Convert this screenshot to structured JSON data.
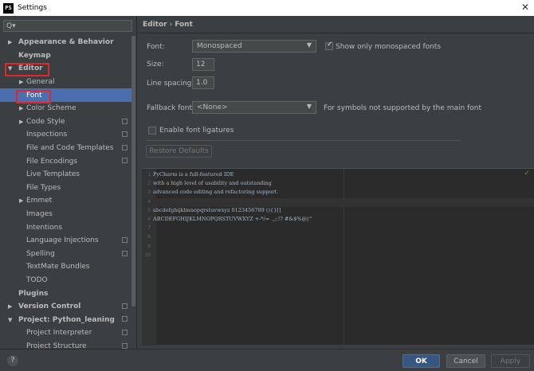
{
  "window": {
    "title": "Settings",
    "app_icon_text": "PS",
    "close_glyph": "✕"
  },
  "search": {
    "placeholder": "Q▾"
  },
  "sidebar": {
    "items": [
      {
        "label": "Appearance & Behavior",
        "arrow": "▶",
        "bold": true,
        "indent": 0
      },
      {
        "label": "Keymap",
        "arrow": "",
        "bold": true,
        "indent": 0
      },
      {
        "label": "Editor",
        "arrow": "▼",
        "bold": true,
        "indent": 0
      },
      {
        "label": "General",
        "arrow": "▶",
        "bold": false,
        "indent": 1
      },
      {
        "label": "Font",
        "arrow": "",
        "bold": false,
        "indent": 1,
        "selected": true
      },
      {
        "label": "Color Scheme",
        "arrow": "▶",
        "bold": false,
        "indent": 1
      },
      {
        "label": "Code Style",
        "arrow": "▶",
        "bold": false,
        "indent": 1,
        "cfg": true
      },
      {
        "label": "Inspections",
        "arrow": "",
        "bold": false,
        "indent": 1,
        "cfg": true
      },
      {
        "label": "File and Code Templates",
        "arrow": "",
        "bold": false,
        "indent": 1,
        "cfg": true
      },
      {
        "label": "File Encodings",
        "arrow": "",
        "bold": false,
        "indent": 1,
        "cfg": true
      },
      {
        "label": "Live Templates",
        "arrow": "",
        "bold": false,
        "indent": 1
      },
      {
        "label": "File Types",
        "arrow": "",
        "bold": false,
        "indent": 1
      },
      {
        "label": "Emmet",
        "arrow": "▶",
        "bold": false,
        "indent": 1
      },
      {
        "label": "Images",
        "arrow": "",
        "bold": false,
        "indent": 1
      },
      {
        "label": "Intentions",
        "arrow": "",
        "bold": false,
        "indent": 1
      },
      {
        "label": "Language Injections",
        "arrow": "",
        "bold": false,
        "indent": 1,
        "cfg": true
      },
      {
        "label": "Spelling",
        "arrow": "",
        "bold": false,
        "indent": 1,
        "cfg": true
      },
      {
        "label": "TextMate Bundles",
        "arrow": "",
        "bold": false,
        "indent": 1
      },
      {
        "label": "TODO",
        "arrow": "",
        "bold": false,
        "indent": 1
      },
      {
        "label": "Plugins",
        "arrow": "",
        "bold": true,
        "indent": 0
      },
      {
        "label": "Version Control",
        "arrow": "▶",
        "bold": true,
        "indent": 0,
        "cfg": true
      },
      {
        "label": "Project: Python_leaning",
        "arrow": "▼",
        "bold": true,
        "indent": 0,
        "cfg": true
      },
      {
        "label": "Project Interpreter",
        "arrow": "",
        "bold": false,
        "indent": 1,
        "cfg": true
      },
      {
        "label": "Project Structure",
        "arrow": "",
        "bold": false,
        "indent": 1,
        "cfg": true
      }
    ]
  },
  "breadcrumb": {
    "parent": "Editor",
    "sep": "›",
    "current": "Font"
  },
  "font_settings": {
    "font_label": "Font:",
    "font_value": "Monospaced",
    "monospaced_only_label": "Show only monospaced fonts",
    "monospaced_only_checked": true,
    "size_label": "Size:",
    "size_value": "12",
    "line_spacing_label": "Line spacing:",
    "line_spacing_value": "1.0",
    "fallback_label": "Fallback font:",
    "fallback_value": "<None>",
    "fallback_hint": "For symbols not supported by the main font",
    "ligatures_label": "Enable font ligatures",
    "ligatures_checked": false,
    "restore_label": "Restore Defaults",
    "dropdown_glyph": "▼"
  },
  "preview": {
    "lines": [
      {
        "num": "1",
        "text": "PyCharm is a full-featured IDE"
      },
      {
        "num": "2",
        "text": "with a high level of usability and outstanding"
      },
      {
        "num": "3",
        "text": "advanced code editing and refactoring support."
      },
      {
        "num": "4",
        "text": ""
      },
      {
        "num": "5",
        "text": "abcdefghijklmnopqrstuvwxyz 0123456789 (){}[]"
      },
      {
        "num": "6",
        "text": "ABCDEFGHIJKLMNOPQRSTUVWXYZ +-*/= .,;:!? #&$%@|^"
      },
      {
        "num": "7",
        "text": ""
      },
      {
        "num": "8",
        "text": ""
      },
      {
        "num": "9",
        "text": ""
      },
      {
        "num": "10",
        "text": ""
      }
    ],
    "status_mark": "✓"
  },
  "footer": {
    "help": "?",
    "ok": "OK",
    "cancel": "Cancel",
    "apply": "Apply"
  },
  "colors": {
    "selection": "#4b6eaf",
    "highlight_box": "#e3262b",
    "ok_button": "#365880"
  }
}
